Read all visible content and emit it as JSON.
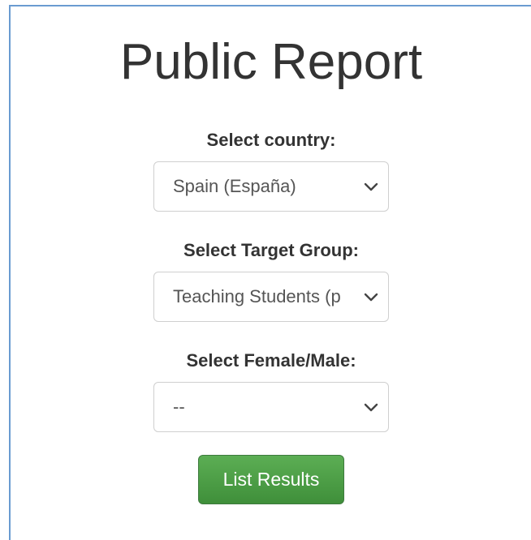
{
  "page": {
    "title": "Public Report"
  },
  "form": {
    "country": {
      "label": "Select country:",
      "value": "Spain (España)"
    },
    "target_group": {
      "label": "Select Target Group:",
      "value": "Teaching Students (p"
    },
    "gender": {
      "label": "Select Female/Male:",
      "value": "--"
    },
    "submit_label": "List Results"
  },
  "colors": {
    "panel_border": "#6a9bd1",
    "button_bg": "#4a9b44",
    "text": "#333333"
  },
  "icons": {
    "select_chevron": "chevron-down-icon"
  }
}
